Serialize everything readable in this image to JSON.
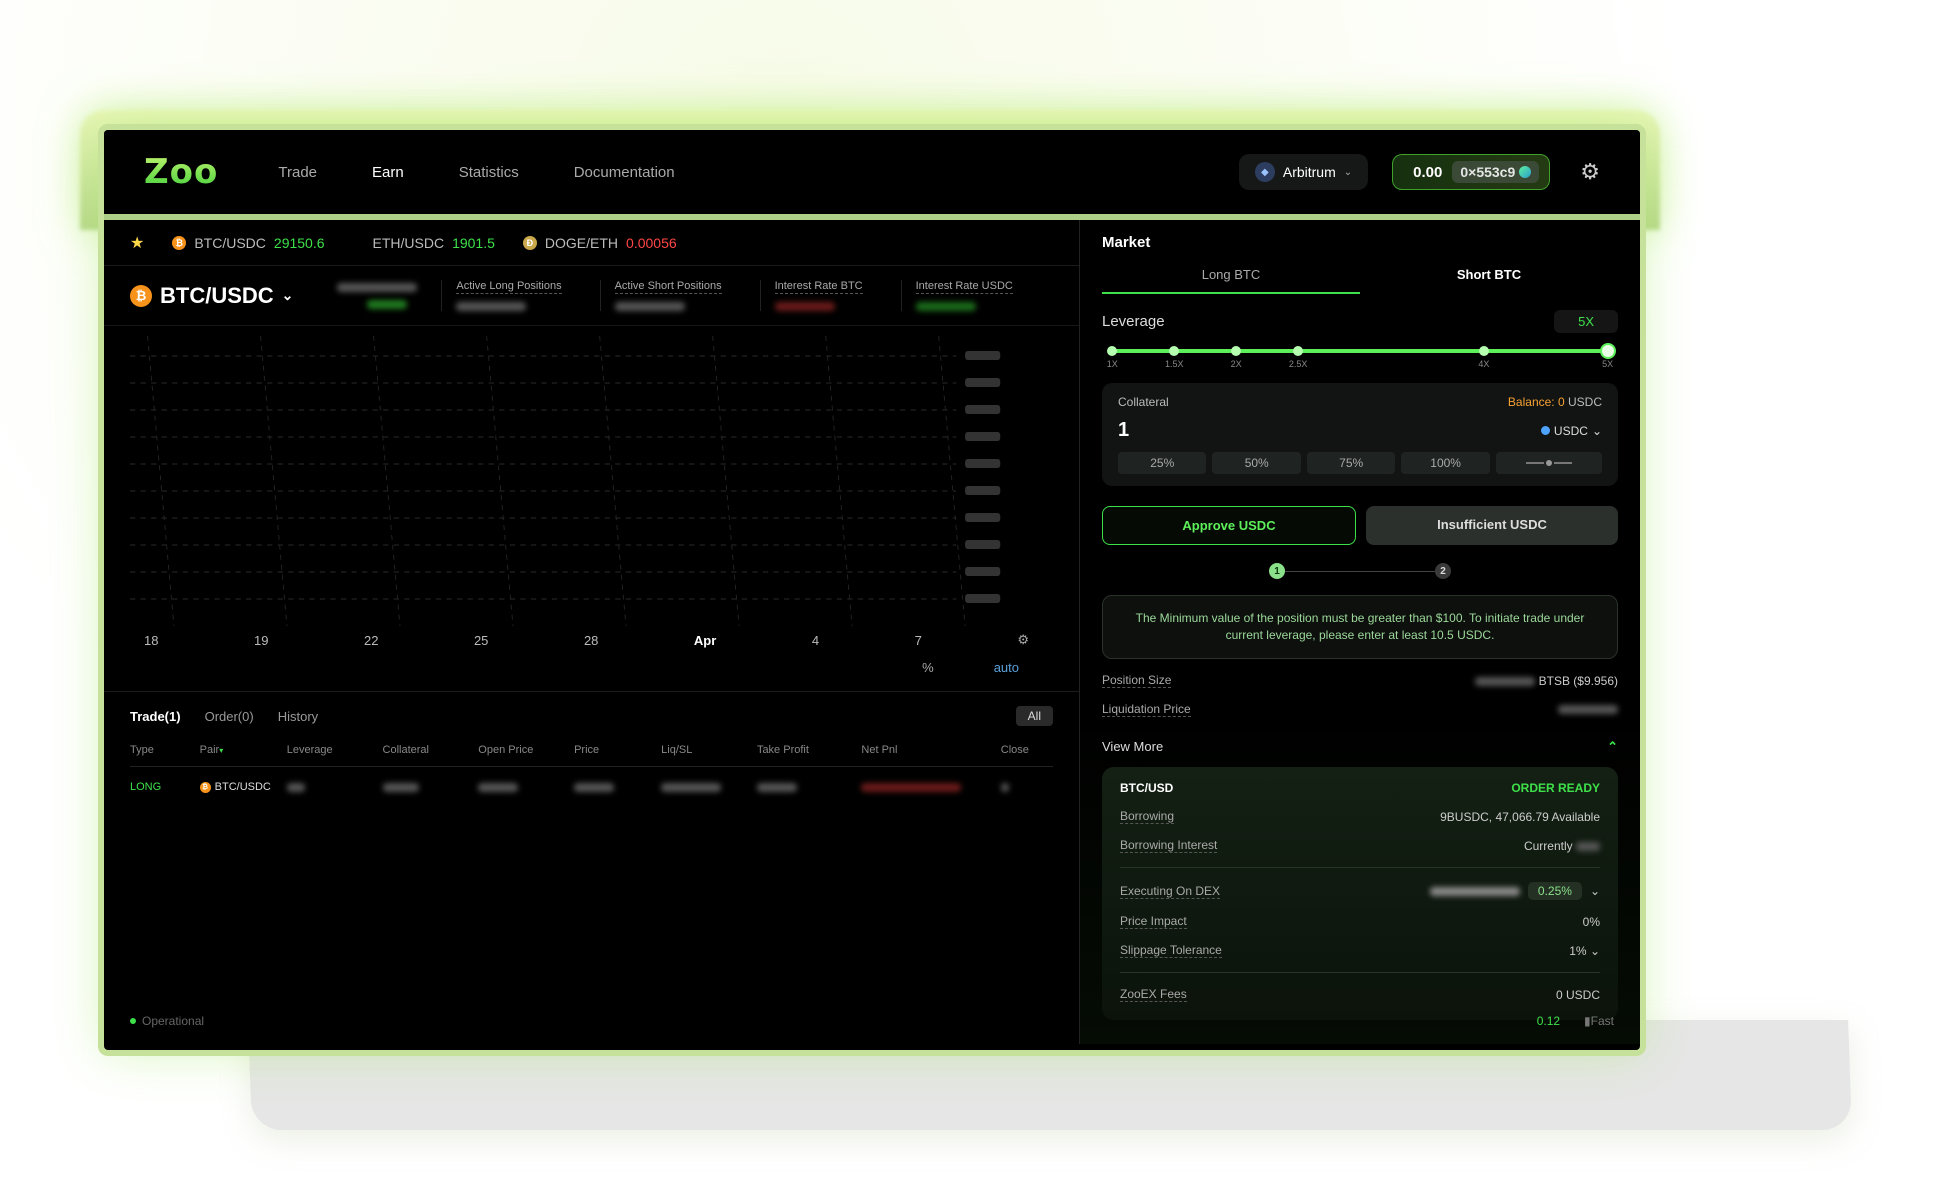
{
  "nav": {
    "logo": "Zoo",
    "items": [
      {
        "label": "Trade",
        "active": false
      },
      {
        "label": "Earn",
        "active": true
      },
      {
        "label": "Statistics",
        "active": false
      },
      {
        "label": "Documentation",
        "active": false
      }
    ],
    "network": "Arbitrum",
    "wallet_balance": "0.00",
    "wallet_address": "0×553c9"
  },
  "ticker": [
    {
      "pair": "BTC/USDC",
      "price": "29150.6",
      "trend": "up",
      "coin": "btc"
    },
    {
      "pair": "ETH/USDC",
      "price": "1901.5",
      "trend": "up",
      "coin": "none"
    },
    {
      "pair": "DOGE/ETH",
      "price": "0.00056",
      "trend": "down",
      "coin": "doge"
    }
  ],
  "pair_header": {
    "pair": "BTC/USDC",
    "stats": [
      {
        "label": "Active Long Positions"
      },
      {
        "label": "Active Short Positions"
      },
      {
        "label": "Interest Rate BTC"
      },
      {
        "label": "Interest Rate USDC"
      }
    ]
  },
  "chart": {
    "x_ticks": [
      "18",
      "19",
      "22",
      "25",
      "28",
      "Apr",
      "4",
      "7"
    ],
    "percent_label": "%",
    "auto_label": "auto"
  },
  "positions": {
    "tabs": [
      {
        "label": "Trade(1)",
        "active": true
      },
      {
        "label": "Order(0)",
        "active": false
      },
      {
        "label": "History",
        "active": false
      }
    ],
    "filter": "All",
    "columns": [
      "Type",
      "Pair",
      "Leverage",
      "Collateral",
      "Open Price",
      "Price",
      "Liq/SL",
      "Take Profit",
      "Net Pnl",
      "Close"
    ],
    "rows": [
      {
        "type": "LONG",
        "pair": "BTC/USDC"
      }
    ]
  },
  "status": {
    "operational": "Operational",
    "version": "0.12",
    "speed": "Fast"
  },
  "panel": {
    "title": "Market",
    "tabs": [
      {
        "label": "Long BTC",
        "active": true
      },
      {
        "label": "Short BTC",
        "active": false
      }
    ],
    "leverage_label": "Leverage",
    "leverage_value": "5X",
    "leverage_stops": [
      "1X",
      "1.5X",
      "2X",
      "2.5X",
      "4X",
      "5X"
    ],
    "leverage_current": 5,
    "collateral_label": "Collateral",
    "balance_label": "Balance: 0",
    "balance_unit": "USDC",
    "collateral_value": "1",
    "token": "USDC",
    "pct_buttons": [
      "25%",
      "50%",
      "75%",
      "100%"
    ],
    "approve_label": "Approve USDC",
    "insufficient_label": "Insufficient USDC",
    "steps": [
      "1",
      "2"
    ],
    "notice": "The Minimum value of the position must be greater than $100. To initiate trade under current leverage, please enter at least 10.5 USDC.",
    "position_size_label": "Position Size",
    "position_size_value": "BTSB ($9.956)",
    "liquidation_label": "Liquidation Price",
    "view_more": "View More",
    "order": {
      "pair": "BTC/USD",
      "status": "ORDER READY",
      "borrowing_label": "Borrowing",
      "borrowing_value": "9BUSDC, 47,066.79 Available",
      "interest_label": "Borrowing Interest",
      "interest_value": "Currently",
      "dex_label": "Executing On DEX",
      "dex_fee": "0.25%",
      "impact_label": "Price Impact",
      "impact_value": "0%",
      "slippage_label": "Slippage Tolerance",
      "slippage_value": "1%",
      "fees_label": "ZooEX Fees",
      "fees_value": "0 USDC"
    }
  }
}
